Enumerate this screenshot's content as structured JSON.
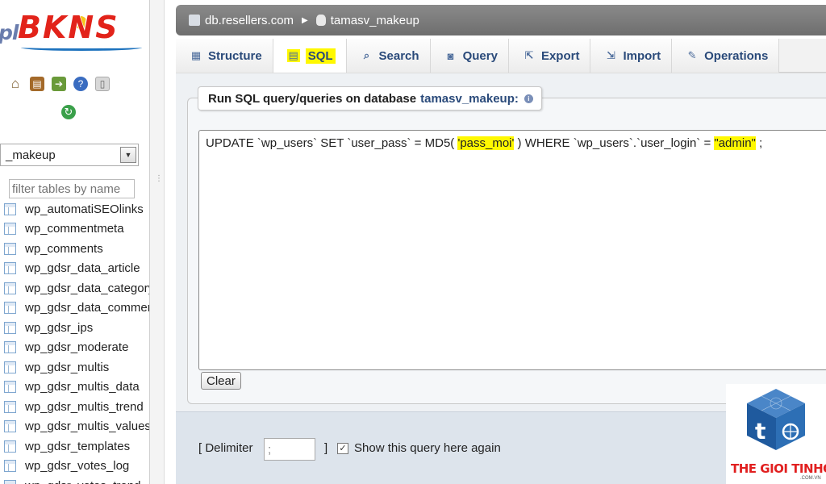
{
  "logo": {
    "pma_text": "pl",
    "brand_text": "BKNS"
  },
  "sidebar": {
    "db_select_value": "_makeup",
    "filter_placeholder": "filter tables by name",
    "tables": [
      "wp_automatiSEOlinks",
      "wp_commentmeta",
      "wp_comments",
      "wp_gdsr_data_article",
      "wp_gdsr_data_category",
      "wp_gdsr_data_comment",
      "wp_gdsr_ips",
      "wp_gdsr_moderate",
      "wp_gdsr_multis",
      "wp_gdsr_multis_data",
      "wp_gdsr_multis_trend",
      "wp_gdsr_multis_values",
      "wp_gdsr_templates",
      "wp_gdsr_votes_log",
      "wp_gdsr_votes_trend"
    ]
  },
  "breadcrumb": {
    "server": "db.resellers.com",
    "database": "tamasv_makeup"
  },
  "tabs": [
    {
      "label": "Structure",
      "icon": "structure-icon"
    },
    {
      "label": "SQL",
      "icon": "sql-icon"
    },
    {
      "label": "Search",
      "icon": "search-icon"
    },
    {
      "label": "Query",
      "icon": "query-icon"
    },
    {
      "label": "Export",
      "icon": "export-icon"
    },
    {
      "label": "Import",
      "icon": "import-icon"
    },
    {
      "label": "Operations",
      "icon": "wrench-icon"
    }
  ],
  "active_tab": "SQL",
  "sql_panel": {
    "legend_prefix": "Run SQL query/queries on database",
    "legend_db": "tamasv_makeup:",
    "query_part1": "UPDATE `wp_users` SET `user_pass` = MD5( ",
    "query_hl1": "'pass_moi'",
    "query_part2": " ) WHERE `wp_users`.`user_login` = ",
    "query_hl2": "\"admin\"",
    "query_part3": " ;",
    "clear_label": "Clear"
  },
  "options": {
    "delimiter_label": "[ Delimiter",
    "delimiter_value": ";",
    "delimiter_close": "]",
    "show_query_label": "Show this query here again",
    "show_query_checked": true
  },
  "watermark": {
    "text": "THE GIOI TINHOC",
    "sub": ".COM.VN"
  },
  "colors": {
    "highlight": "#fff800",
    "tab_text": "#2a4a7a",
    "breadcrumb_bg": "#7a7a7a",
    "brand_red": "#e2231a"
  }
}
